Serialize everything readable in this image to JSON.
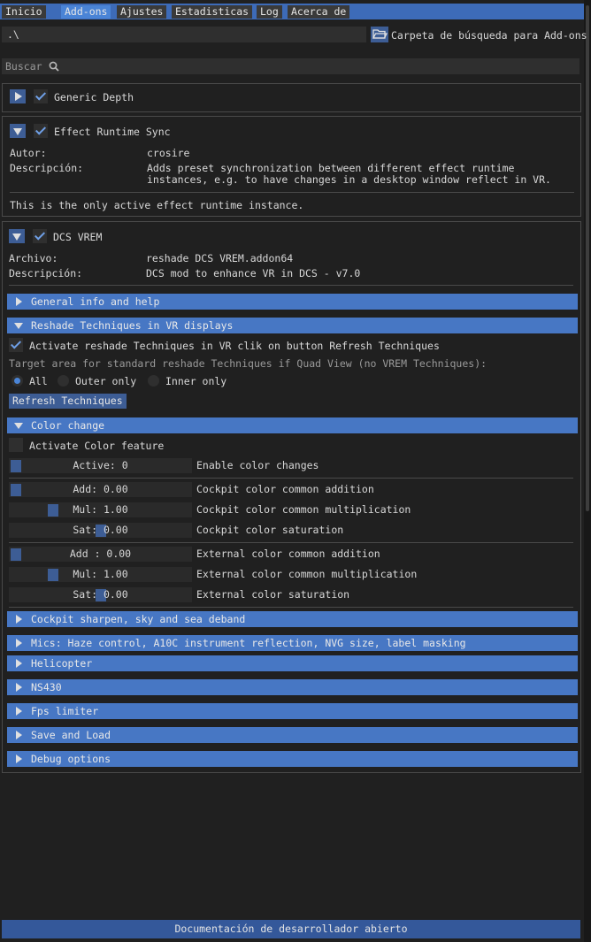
{
  "tabs": [
    {
      "label": "Inicio",
      "active": false
    },
    {
      "label": "Add-ons",
      "active": true
    },
    {
      "label": "Ajustes",
      "active": false
    },
    {
      "label": "Estadisticas",
      "active": false
    },
    {
      "label": "Log",
      "active": false
    },
    {
      "label": "Acerca de",
      "active": false
    }
  ],
  "path_bar": {
    "path_value": ".\\",
    "folder_icon": "folder-open-icon",
    "folder_button_label": "Carpeta de búsqueda para Add-ons"
  },
  "search": {
    "placeholder": "Buscar",
    "icon": "search-icon"
  },
  "addons": {
    "generic_depth": {
      "name": "Generic Depth",
      "enabled": true,
      "expanded": false
    },
    "effect_runtime_sync": {
      "name": "Effect Runtime Sync",
      "enabled": true,
      "expanded": true,
      "author_label": "Autor:",
      "author_value": "crosire",
      "desc_label": "Descripción:",
      "desc_line1": "Adds preset synchronization between different effect runtime",
      "desc_line2": "instances, e.g. to have changes in a desktop window reflect in VR.",
      "note": "This is the only active effect runtime instance."
    },
    "dcs_vrem": {
      "name": "DCS VREM",
      "enabled": true,
      "expanded": true,
      "file_label": "Archivo:",
      "file_value": "reshade DCS VREM.addon64",
      "desc_label": "Descripción:",
      "desc_value": "DCS mod to enhance VR in DCS - v7.0"
    }
  },
  "sections": {
    "general_info": "General info and help",
    "reshade_vr": "Reshade Techniques in VR displays",
    "color_change": "Color change",
    "cockpit_sharpen": "Cockpit sharpen, sky and sea deband",
    "mics": "Mics: Haze control, A10C instrument reflection, NVG size, label masking",
    "helicopter": "Helicopter",
    "ns430": "NS430",
    "fps_limiter": "Fps limiter",
    "save_load": "Save and Load",
    "debug": "Debug options"
  },
  "reshade_vr": {
    "activate_label": "Activate reshade Techniques in VR clik on button Refresh Techniques",
    "activate_checked": true,
    "target_label": "Target area for standard reshade Techniques if Quad View (no VREM Techniques):",
    "radio_options": [
      "All",
      "Outer only",
      "Inner only"
    ],
    "radio_selected": "All",
    "refresh_button": "Refresh Techniques"
  },
  "color_change": {
    "activate_label": "Activate Color feature",
    "activate_checked": false,
    "sliders": [
      {
        "text": "Active: 0",
        "label": "Enable color changes",
        "fraction": 0.0
      },
      {
        "text": "Add: 0.00",
        "label": "Cockpit color common addition",
        "fraction": 0.0
      },
      {
        "text": "Mul: 1.00",
        "label": "Cockpit color common multiplication",
        "fraction": 0.22
      },
      {
        "text": "Sat: 0.00",
        "label": "Cockpit color saturation",
        "fraction": 0.5
      },
      {
        "text": "Add : 0.00",
        "label": "External color common addition",
        "fraction": 0.0
      },
      {
        "text": "Mul: 1.00",
        "label": "External color common multiplication",
        "fraction": 0.22
      },
      {
        "text": "Sat: 0.00",
        "label": "External color saturation",
        "fraction": 0.5
      }
    ]
  },
  "status_bar": "Documentación de desarrollador abierto",
  "colors": {
    "header_blue": "#4777c4",
    "active_tab": "#4a84d6",
    "button_blue": "#3d5d95",
    "background": "#202020"
  }
}
